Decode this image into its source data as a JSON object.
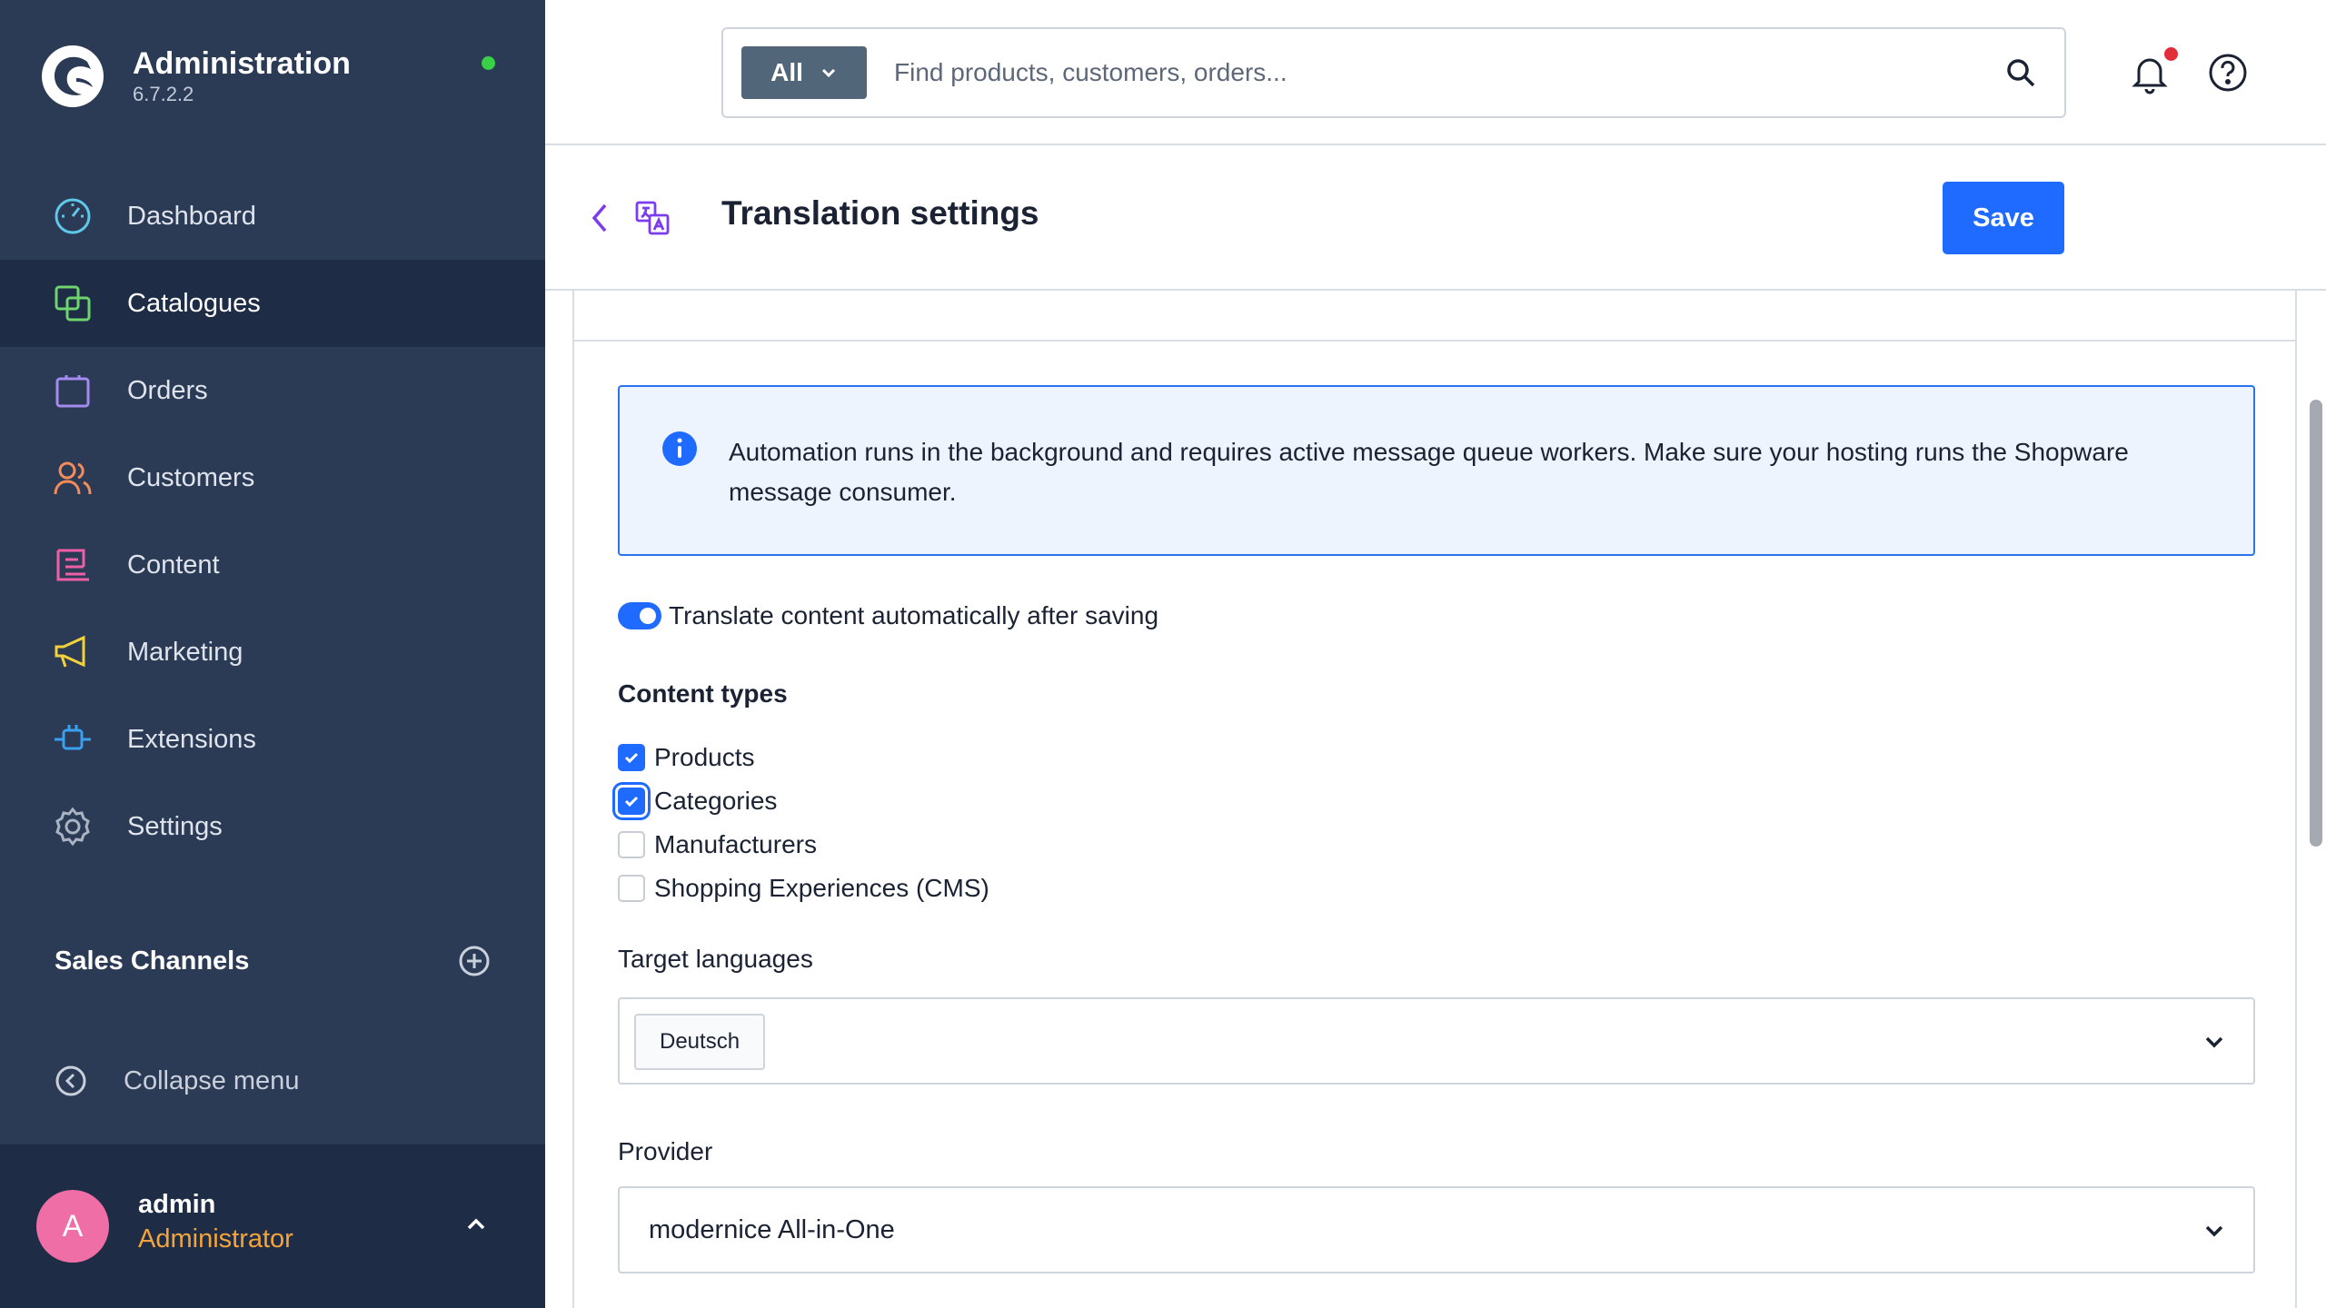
{
  "brand": {
    "title": "Administration",
    "version": "6.7.2.2"
  },
  "nav": {
    "items": [
      {
        "label": "Dashboard",
        "icon": "dashboard-icon",
        "color": "#5fc7e8"
      },
      {
        "label": "Catalogues",
        "icon": "catalogues-icon",
        "color": "#6ed56e",
        "active": true
      },
      {
        "label": "Orders",
        "icon": "orders-icon",
        "color": "#a58bf0"
      },
      {
        "label": "Customers",
        "icon": "customers-icon",
        "color": "#f48b5a"
      },
      {
        "label": "Content",
        "icon": "content-icon",
        "color": "#ef5fa6"
      },
      {
        "label": "Marketing",
        "icon": "marketing-icon",
        "color": "#f3d13a"
      },
      {
        "label": "Extensions",
        "icon": "extensions-icon",
        "color": "#3aa0f0"
      },
      {
        "label": "Settings",
        "icon": "settings-icon",
        "color": "#aab3c2"
      }
    ],
    "sales_channels": "Sales Channels",
    "collapse": "Collapse menu"
  },
  "user": {
    "initial": "A",
    "name": "admin",
    "role": "Administrator"
  },
  "search": {
    "filter": "All",
    "placeholder": "Find products, customers, orders..."
  },
  "page": {
    "title": "Translation settings",
    "save": "Save"
  },
  "info": {
    "text": "Automation runs in the background and requires active message queue workers. Make sure your hosting runs the Shopware message consumer."
  },
  "auto_translate": {
    "label": "Translate content automatically after saving",
    "enabled": true
  },
  "content_types": {
    "title": "Content types",
    "items": [
      {
        "label": "Products",
        "checked": true
      },
      {
        "label": "Categories",
        "checked": true
      },
      {
        "label": "Manufacturers",
        "checked": false
      },
      {
        "label": "Shopping Experiences (CMS)",
        "checked": false
      }
    ]
  },
  "target_languages": {
    "label": "Target languages",
    "chips": [
      "Deutsch"
    ]
  },
  "provider": {
    "label": "Provider",
    "value": "modernice All-in-One"
  },
  "colors": {
    "sidebar": "#2b3a55",
    "sidebar_active": "#1e2c45",
    "accent": "#1f6bff",
    "user_role": "#f5a43a",
    "avatar": "#ee6ea5"
  }
}
